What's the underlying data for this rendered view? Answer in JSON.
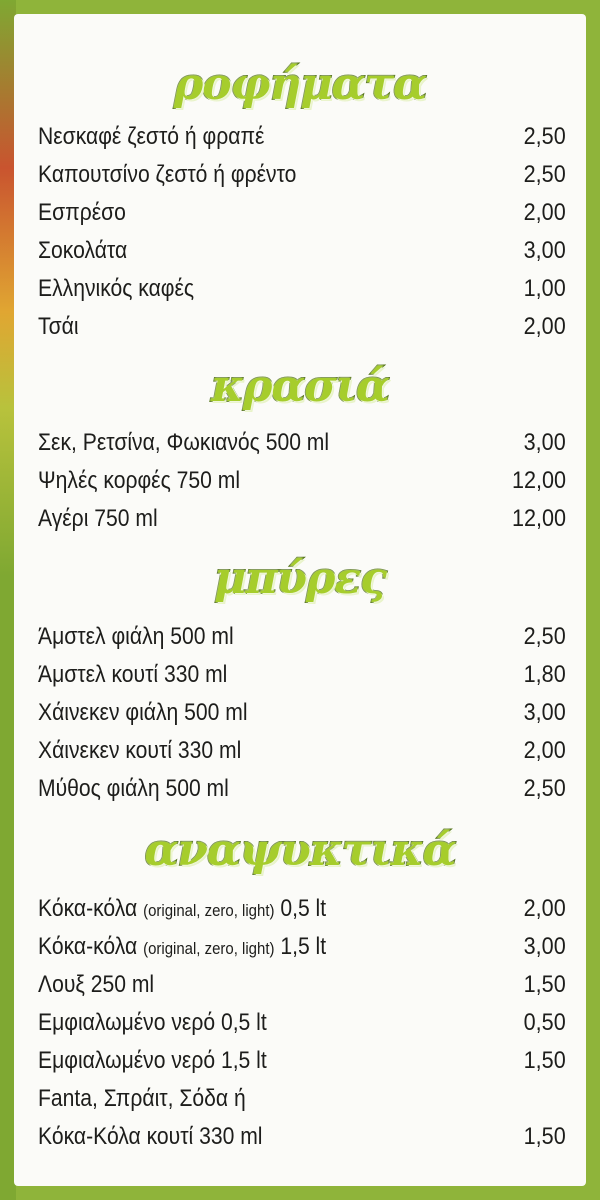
{
  "colors": {
    "background_green": "#8fb43a",
    "card": "#fbfbf8",
    "title_fill": "#a6cd2c",
    "title_outline": "#4c6d10",
    "text": "#1d1d1b"
  },
  "sections": [
    {
      "title": "ροφήματα",
      "items": [
        {
          "name": "Νεσκαφέ ζεστό ή φραπέ",
          "price": "2,50"
        },
        {
          "name": "Καπουτσίνο ζεστό ή φρέντο",
          "price": "2,50"
        },
        {
          "name": "Εσπρέσο",
          "price": "2,00"
        },
        {
          "name": "Σοκολάτα",
          "price": "3,00"
        },
        {
          "name": "Ελληνικός καφές",
          "price": "1,00"
        },
        {
          "name": "Τσάι",
          "price": "2,00"
        }
      ]
    },
    {
      "title": "κρασιά",
      "items": [
        {
          "name": "Σεκ, Ρετσίνα, Φωκιανός 500 ml",
          "price": "3,00"
        },
        {
          "name": "Ψηλές κορφές 750 ml",
          "price": "12,00"
        },
        {
          "name": "Αγέρι 750 ml",
          "price": "12,00"
        }
      ]
    },
    {
      "title": "μπύρες",
      "items": [
        {
          "name": "Άμστελ φιάλη 500 ml",
          "price": "2,50"
        },
        {
          "name": "Άμστελ κουτί 330 ml",
          "price": "1,80"
        },
        {
          "name": "Χάινεκεν φιάλη 500 ml",
          "price": "3,00"
        },
        {
          "name": "Χάινεκεν κουτί 330 ml",
          "price": "2,00"
        },
        {
          "name": "Μύθος φιάλη 500 ml",
          "price": "2,50"
        }
      ]
    },
    {
      "title": "αναψυκτικά",
      "items": [
        {
          "name": "Κόκα-κόλα",
          "note": "(original, zero, light)",
          "size": "0,5 lt",
          "price": "2,00"
        },
        {
          "name": "Κόκα-κόλα",
          "note": "(original, zero, light)",
          "size": "1,5 lt",
          "price": "3,00"
        },
        {
          "name": "Λουξ 250 ml",
          "price": "1,50"
        },
        {
          "name": "Εμφιαλωμένο νερό 0,5 lt",
          "price": "0,50"
        },
        {
          "name": "Εμφιαλωμένο νερό 1,5 lt",
          "price": "1,50"
        },
        {
          "name": "Fanta, Σπράιτ, Σόδα ή",
          "price": ""
        },
        {
          "name": "Κόκα-Κόλα κουτί 330 ml",
          "price": "1,50"
        }
      ]
    }
  ]
}
